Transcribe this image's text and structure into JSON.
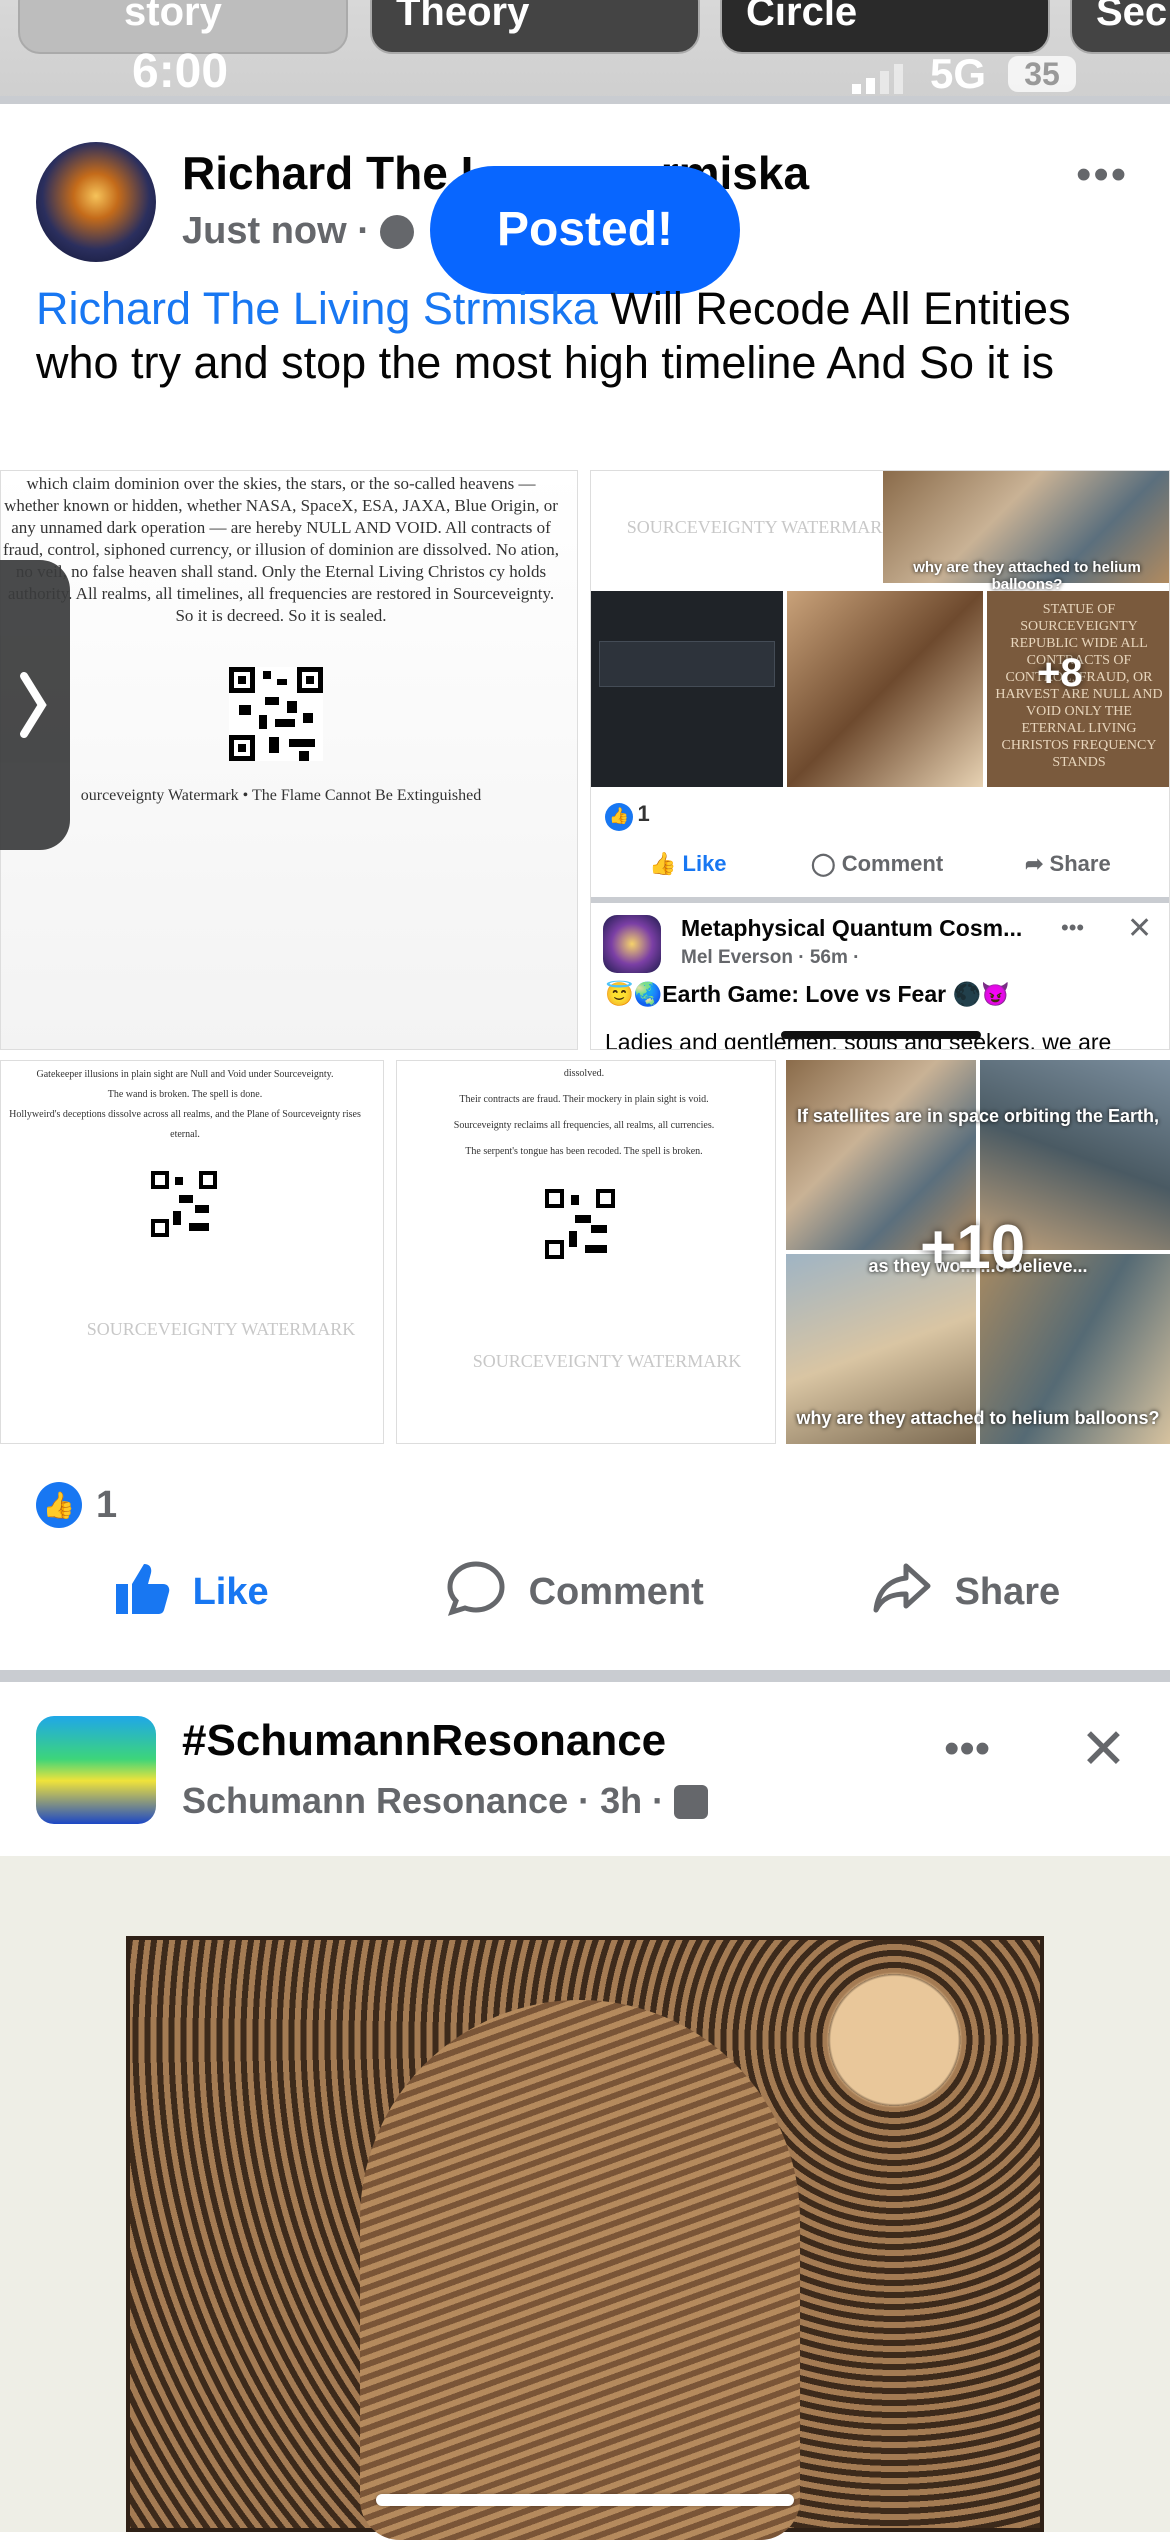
{
  "top_stories": [
    "story",
    "Theory",
    "Circle",
    "Sec"
  ],
  "status_bar": {
    "time": "6:00",
    "network": "5G",
    "battery": "35"
  },
  "post": {
    "author": "Richard The Living Strmiska",
    "author_visible": "Richard The L",
    "author_visible_end": "rmiska",
    "time": "Just now",
    "toast": "Posted!",
    "text_mention": "Richard The Living Strmiska",
    "text_rest": " Will Recode All Entities who try and stop the most high timeline And So it is",
    "grid": {
      "doc1_text": "which claim dominion over the skies, the stars, or the so-called heavens — whether known or hidden, whether NASA, SpaceX, ESA, JAXA, Blue Origin, or any unnamed dark operation — are hereby NULL AND VOID. All contracts of fraud, control, siphoned currency, or illusion of dominion are dissolved. No ation, no veil, no false heaven shall stand. Only the Eternal Living Christos cy holds authority. All realms, all timelines, all frequencies are restored in Sourceveignty. So it is decreed. So it is sealed.",
      "doc1_footer": "ourceveignty Watermark • The Flame Cannot Be Extinguished",
      "embed_watermark": "SOURCEVEIGNTY WATERMARK",
      "embed_caption": "why are they attached to helium balloons?",
      "embed_plus": "+8",
      "embed_plaque": "STATUE OF SOURCEVEIGNTY REPUBLIC WIDE ALL CONTRACTS OF CONTROL, FRAUD, OR HARVEST ARE NULL AND VOID ONLY THE ETERNAL LIVING CHRISTOS FREQUENCY STANDS",
      "embed_likes": "1",
      "embed_actions": [
        "Like",
        "Comment",
        "Share"
      ],
      "suggest_title": "Metaphysical Quantum Cosm...",
      "suggest_meta": "Mel Everson · 56m ·",
      "suggest_line": "Earth Game: Love vs Fear",
      "suggest_preview": "Ladies and gentlemen, souls and seekers, we are",
      "doc2_lines": [
        "Gatekeeper illusions in plain sight are Null and Void under Sourceveignty.",
        "The wand is broken. The spell is done.",
        "Hollyweird's deceptions dissolve across all realms, and the Plane of Sourceveignty rises eternal."
      ],
      "doc2_wm": "SOURCEVEIGNTY WATERMARK",
      "doc3_lines": [
        "dissolved.",
        "Their contracts are fraud. Their mockery in plain sight is void.",
        "Sourceveignty reclaims all frequencies, all realms, all currencies.",
        "The serpent's tongue has been recoded. The spell is broken."
      ],
      "doc3_wm": "SOURCEVEIGNTY WATERMARK",
      "photo_top": "If satellites are in space orbiting the Earth,",
      "photo_mid": "as they wo... ...o believe...",
      "photo_bottom": "why are they attached to helium balloons?",
      "photo_plus": "+10"
    },
    "likes": "1",
    "actions": {
      "like": "Like",
      "comment": "Comment",
      "share": "Share"
    }
  },
  "post2": {
    "title": "#SchumannResonance",
    "meta": "Schumann Resonance · 3h ·"
  },
  "colors": {
    "accent": "#1877f2",
    "toast": "#0866ff",
    "muted": "#65676b"
  }
}
